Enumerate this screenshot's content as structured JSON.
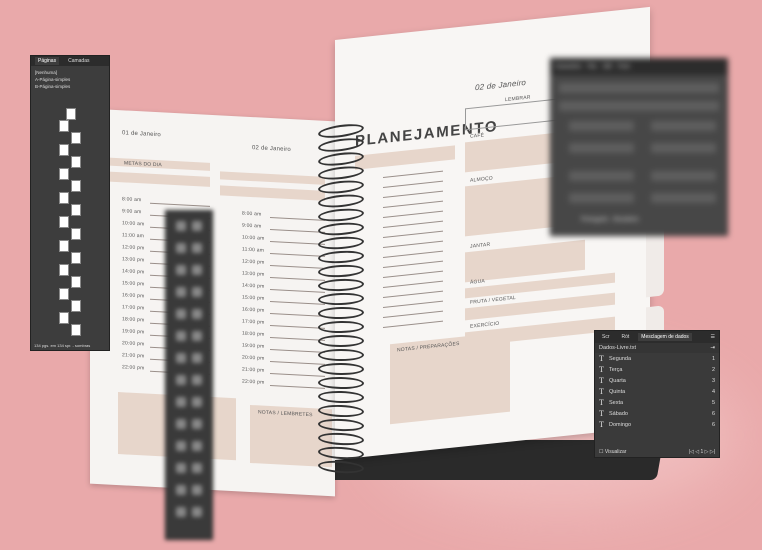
{
  "planner": {
    "title": "PLANEJAMENTO",
    "right_date": "02 de Janeiro",
    "left_date_a": "01 de Janeiro",
    "left_date_b": "02 de Janeiro",
    "left_section_header": "METAS DO DIA",
    "times": [
      "8:00 am",
      "9:00 am",
      "10:00 am",
      "11:00 am",
      "12:00 pm",
      "13:00 pm",
      "14:00 pm",
      "15:00 pm",
      "16:00 pm",
      "17:00 pm",
      "18:00 pm",
      "19:00 pm",
      "20:00 pm",
      "21:00 pm",
      "22:00 pm"
    ],
    "right_sections": [
      "CAFÉ",
      "ALMOÇO",
      "JANTAR",
      "ÁGUA",
      "FRUTA / VEGETAL",
      "EXERCÍCIO"
    ],
    "notes_label": "NOTAS / PREPARAÇÕES",
    "notes_left_label": "NOTAS / LEMBRETES",
    "reminder_label": "LEMBRAR"
  },
  "pages_panel": {
    "tabs": [
      "Páginas",
      "Camadas"
    ],
    "rows": [
      "[Nenhuma]",
      "A-Página-simples",
      "B-Página-simples"
    ],
    "footer": "134 pgs. em 134 spr. - sombras"
  },
  "merge_panel": {
    "tabs": [
      "Scr",
      "Rót",
      "Mesclagem de dados"
    ],
    "file": "Dados-Livre.txt",
    "items": [
      {
        "name": "Segunda",
        "num": "1"
      },
      {
        "name": "Terça",
        "num": "2"
      },
      {
        "name": "Quarta",
        "num": "3"
      },
      {
        "name": "Quinta",
        "num": "4"
      },
      {
        "name": "Sexta",
        "num": "5"
      },
      {
        "name": "Sábado",
        "num": "6"
      },
      {
        "name": "Domingo",
        "num": "6"
      }
    ],
    "preview_label": "Visualizar",
    "page": "1"
  },
  "char_panel": {
    "tabs": [
      "Caractere",
      "Par",
      "Glif",
      "Font"
    ],
    "language": "Português - Brasileiro"
  }
}
